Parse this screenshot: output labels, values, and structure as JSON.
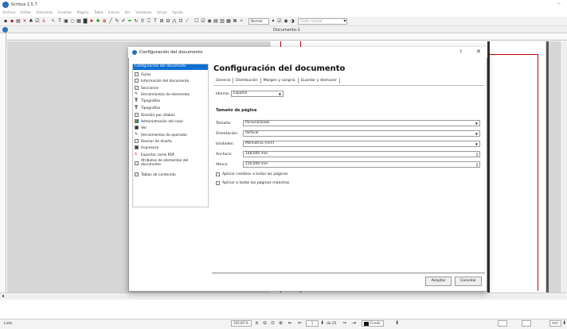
{
  "app": {
    "title": "Scribus 1.5.7",
    "minimize": "—"
  },
  "menubar": [
    "Archivo",
    "Editar",
    "Elemento",
    "Insertar",
    "Página",
    "Tabla",
    "Extras",
    "Ver",
    "Ventanas",
    "Script",
    "Ayuda"
  ],
  "toolbar": {
    "mode_select": "Normal",
    "preview_select": "Visión normal"
  },
  "document": {
    "title": "Documento-1"
  },
  "statusbar": {
    "left_text": "Listo",
    "zoom": "100,00 %",
    "page_current": "1",
    "page_total": "de 25",
    "layer": "Fondo",
    "unit": "mm"
  },
  "dialog": {
    "title": "Configuración del documento",
    "help": "?",
    "close": "✕",
    "nav_items": [
      {
        "label": "Configuración del documento",
        "icon": "document-settings-icon",
        "selected": true
      },
      {
        "label": "Guías",
        "icon": "guides-icon"
      },
      {
        "label": "Información del documento",
        "icon": "info-icon"
      },
      {
        "label": "Secciones",
        "icon": "sections-icon"
      },
      {
        "label": "Herramientas de elementos",
        "icon": "tools-icon"
      },
      {
        "label": "Tipografías",
        "icon": "typography-icon"
      },
      {
        "label": "Tipografías",
        "icon": "fonts-icon"
      },
      {
        "label": "División por sílabas",
        "icon": "hyphenation-icon"
      },
      {
        "label": "Administración del color",
        "icon": "color-management-icon"
      },
      {
        "label": "Ver",
        "icon": "display-icon"
      },
      {
        "label": "Herramientas de operador",
        "icon": "operator-tools-icon"
      },
      {
        "label": "Revisor de diseño",
        "icon": "preflight-icon"
      },
      {
        "label": "Impresora",
        "icon": "printer-icon"
      },
      {
        "label": "Exportar como PDF",
        "icon": "pdf-export-icon"
      },
      {
        "label": "Atributos de elementos del documento",
        "icon": "attributes-icon"
      },
      {
        "label": "Tablas de contenido",
        "icon": "toc-icon"
      }
    ],
    "heading": "Configuración del documento",
    "tabs": [
      "General",
      "Distribución",
      "Margen y sangría",
      "Guardar y deshacer"
    ],
    "language_label": "Idioma:",
    "language_value": "Español",
    "page_size_title": "Tamaño de página",
    "fields": {
      "size_label": "Tamaño:",
      "size_value": "Personalizado",
      "orientation_label": "Orientación:",
      "orientation_value": "Vertical",
      "units_label": "Unidades:",
      "units_value": "Milímetros (mm)",
      "width_label": "Anchura:",
      "width_value": "148,000 mm",
      "height_label": "Altura:",
      "height_value": "210,000 mm"
    },
    "checkboxes": {
      "apply_all_pages": "Aplicar cambios a todas las páginas",
      "apply_master_pages": "Aplicar a todas las páginas maestras"
    },
    "buttons": {
      "ok": "Aceptar",
      "cancel": "Cancelar"
    }
  },
  "colors": {
    "accent": "#0a6fd4",
    "guide_red": "#c00000"
  }
}
